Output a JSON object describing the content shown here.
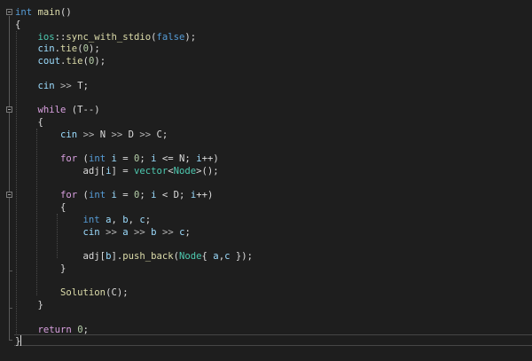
{
  "editor": {
    "lines": [
      [
        {
          "t": "int",
          "c": "kw"
        },
        {
          "t": " "
        },
        {
          "t": "main",
          "c": "fn"
        },
        {
          "t": "()"
        }
      ],
      [
        {
          "t": "{"
        }
      ],
      [
        {
          "t": "    "
        },
        {
          "t": "ios",
          "c": "ty"
        },
        {
          "t": "::"
        },
        {
          "t": "sync_with_stdio",
          "c": "fn"
        },
        {
          "t": "("
        },
        {
          "t": "false",
          "c": "kw"
        },
        {
          "t": ");"
        }
      ],
      [
        {
          "t": "    "
        },
        {
          "t": "cin",
          "c": "var"
        },
        {
          "t": "."
        },
        {
          "t": "tie",
          "c": "fn"
        },
        {
          "t": "("
        },
        {
          "t": "0",
          "c": "num"
        },
        {
          "t": ");"
        }
      ],
      [
        {
          "t": "    "
        },
        {
          "t": "cout",
          "c": "var"
        },
        {
          "t": "."
        },
        {
          "t": "tie",
          "c": "fn"
        },
        {
          "t": "("
        },
        {
          "t": "0",
          "c": "num"
        },
        {
          "t": ");"
        }
      ],
      [
        {
          "t": ""
        }
      ],
      [
        {
          "t": "    "
        },
        {
          "t": "cin",
          "c": "var"
        },
        {
          "t": " "
        },
        {
          "t": ">>",
          "c": "op"
        },
        {
          "t": " T;"
        }
      ],
      [
        {
          "t": ""
        }
      ],
      [
        {
          "t": "    "
        },
        {
          "t": "while",
          "c": "kw2"
        },
        {
          "t": " (T--)"
        }
      ],
      [
        {
          "t": "    {"
        }
      ],
      [
        {
          "t": "        "
        },
        {
          "t": "cin",
          "c": "var"
        },
        {
          "t": " "
        },
        {
          "t": ">>",
          "c": "op"
        },
        {
          "t": " N "
        },
        {
          "t": ">>",
          "c": "op"
        },
        {
          "t": " D "
        },
        {
          "t": ">>",
          "c": "op"
        },
        {
          "t": " C;"
        }
      ],
      [
        {
          "t": ""
        }
      ],
      [
        {
          "t": "        "
        },
        {
          "t": "for",
          "c": "kw2"
        },
        {
          "t": " ("
        },
        {
          "t": "int",
          "c": "kw"
        },
        {
          "t": " "
        },
        {
          "t": "i",
          "c": "var"
        },
        {
          "t": " = "
        },
        {
          "t": "0",
          "c": "num"
        },
        {
          "t": "; "
        },
        {
          "t": "i",
          "c": "var"
        },
        {
          "t": " <= N; "
        },
        {
          "t": "i",
          "c": "var"
        },
        {
          "t": "++)"
        }
      ],
      [
        {
          "t": "            adj["
        },
        {
          "t": "i",
          "c": "var"
        },
        {
          "t": "] = "
        },
        {
          "t": "vector",
          "c": "ty"
        },
        {
          "t": "<"
        },
        {
          "t": "Node",
          "c": "ty"
        },
        {
          "t": ">();"
        }
      ],
      [
        {
          "t": ""
        }
      ],
      [
        {
          "t": "        "
        },
        {
          "t": "for",
          "c": "kw2"
        },
        {
          "t": " ("
        },
        {
          "t": "int",
          "c": "kw"
        },
        {
          "t": " "
        },
        {
          "t": "i",
          "c": "var"
        },
        {
          "t": " = "
        },
        {
          "t": "0",
          "c": "num"
        },
        {
          "t": "; "
        },
        {
          "t": "i",
          "c": "var"
        },
        {
          "t": " < D; "
        },
        {
          "t": "i",
          "c": "var"
        },
        {
          "t": "++)"
        }
      ],
      [
        {
          "t": "        {"
        }
      ],
      [
        {
          "t": "            "
        },
        {
          "t": "int",
          "c": "kw"
        },
        {
          "t": " "
        },
        {
          "t": "a",
          "c": "var"
        },
        {
          "t": ", "
        },
        {
          "t": "b",
          "c": "var"
        },
        {
          "t": ", "
        },
        {
          "t": "c",
          "c": "var"
        },
        {
          "t": ";"
        }
      ],
      [
        {
          "t": "            "
        },
        {
          "t": "cin",
          "c": "var"
        },
        {
          "t": " "
        },
        {
          "t": ">>",
          "c": "op"
        },
        {
          "t": " "
        },
        {
          "t": "a",
          "c": "var"
        },
        {
          "t": " "
        },
        {
          "t": ">>",
          "c": "op"
        },
        {
          "t": " "
        },
        {
          "t": "b",
          "c": "var"
        },
        {
          "t": " "
        },
        {
          "t": ">>",
          "c": "op"
        },
        {
          "t": " "
        },
        {
          "t": "c",
          "c": "var"
        },
        {
          "t": ";"
        }
      ],
      [
        {
          "t": ""
        }
      ],
      [
        {
          "t": "            adj["
        },
        {
          "t": "b",
          "c": "var"
        },
        {
          "t": "]."
        },
        {
          "t": "push_back",
          "c": "fn"
        },
        {
          "t": "("
        },
        {
          "t": "Node",
          "c": "ty"
        },
        {
          "t": "{ "
        },
        {
          "t": "a",
          "c": "var"
        },
        {
          "t": ","
        },
        {
          "t": "c",
          "c": "var"
        },
        {
          "t": " });"
        }
      ],
      [
        {
          "t": "        }"
        }
      ],
      [
        {
          "t": ""
        }
      ],
      [
        {
          "t": "        "
        },
        {
          "t": "Solution",
          "c": "fn"
        },
        {
          "t": "(C);"
        }
      ],
      [
        {
          "t": "    }"
        }
      ],
      [
        {
          "t": ""
        }
      ],
      [
        {
          "t": "    "
        },
        {
          "t": "return",
          "c": "kw2"
        },
        {
          "t": " "
        },
        {
          "t": "0",
          "c": "num"
        },
        {
          "t": ";"
        }
      ],
      [
        {
          "t": "}"
        }
      ]
    ]
  }
}
